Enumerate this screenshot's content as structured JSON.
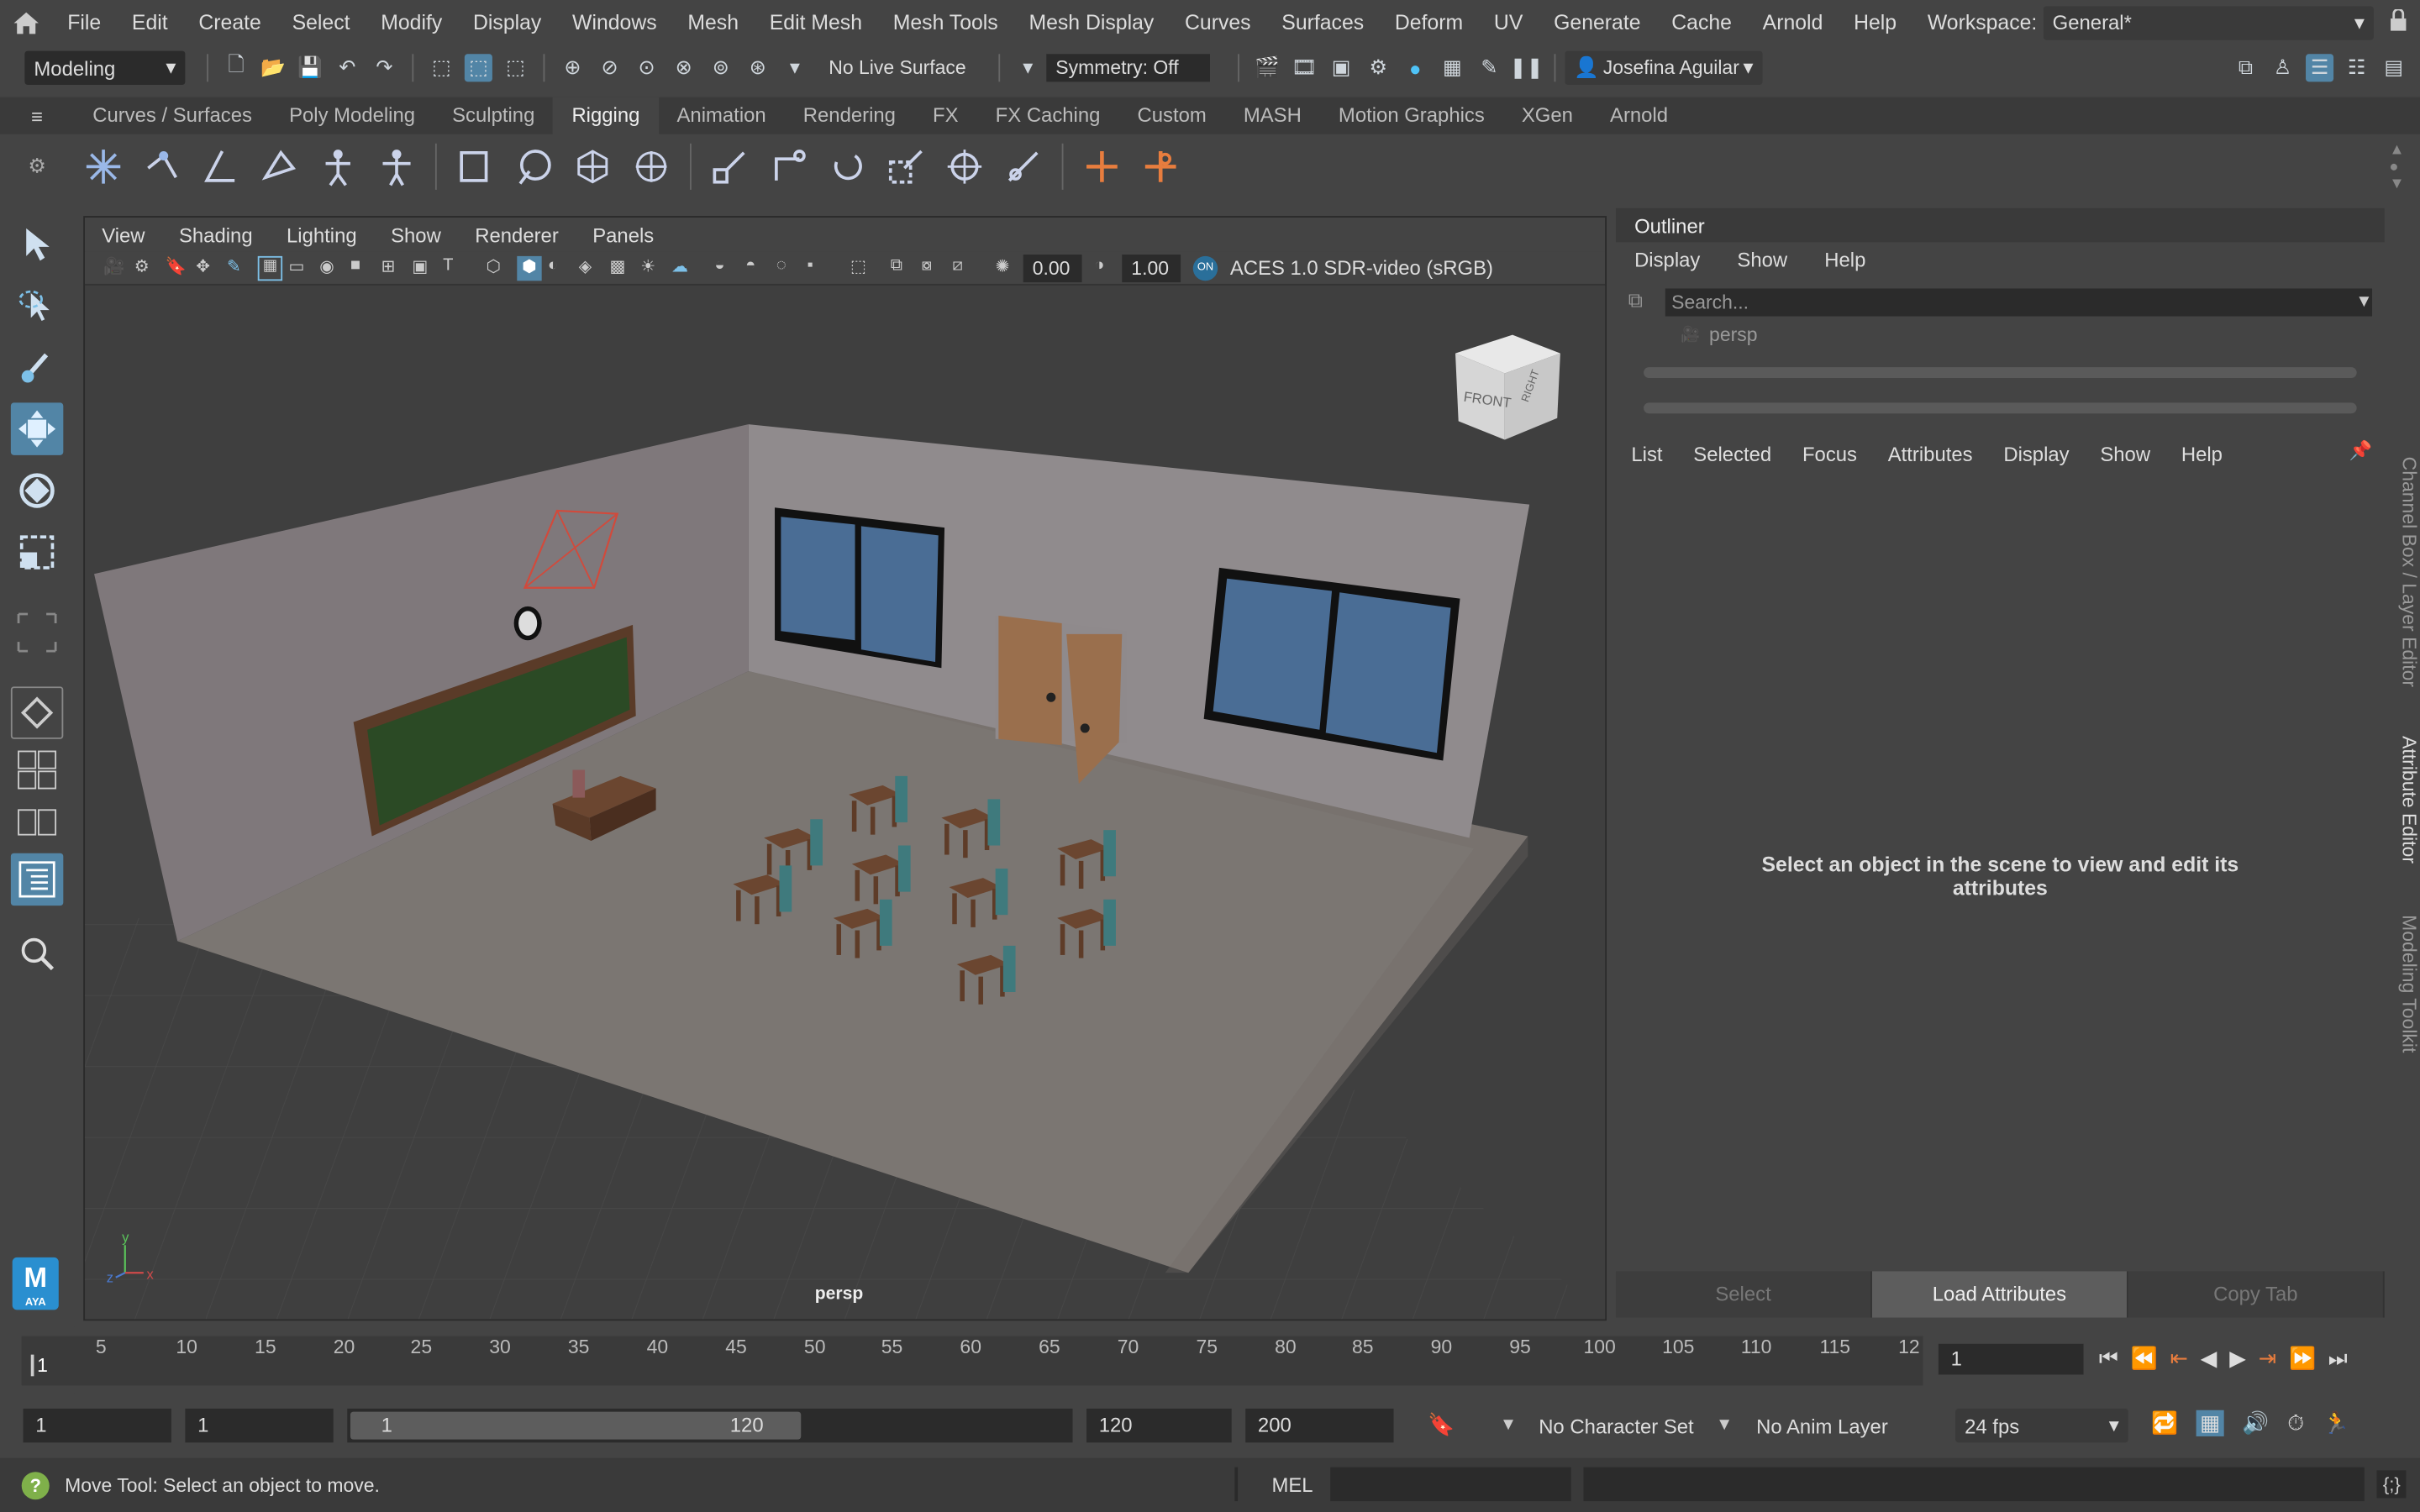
{
  "menubar": {
    "items": [
      "File",
      "Edit",
      "Create",
      "Select",
      "Modify",
      "Display",
      "Windows",
      "Mesh",
      "Edit Mesh",
      "Mesh Tools",
      "Mesh Display",
      "Curves",
      "Surfaces",
      "Deform",
      "UV",
      "Generate",
      "Cache",
      "Arnold",
      "Help"
    ],
    "workspace_label": "Workspace:",
    "workspace_value": "General*"
  },
  "statusline": {
    "mode": "Modeling",
    "live_surface": "No Live Surface",
    "symmetry": "Symmetry: Off",
    "user": "Josefina Aguilar"
  },
  "shelf": {
    "tabs": [
      "Curves / Surfaces",
      "Poly Modeling",
      "Sculpting",
      "Rigging",
      "Animation",
      "Rendering",
      "FX",
      "FX Caching",
      "Custom",
      "MASH",
      "Motion Graphics",
      "XGen",
      "Arnold"
    ],
    "active": "Rigging"
  },
  "viewport": {
    "menu": [
      "View",
      "Shading",
      "Lighting",
      "Show",
      "Renderer",
      "Panels"
    ],
    "exposure": "0.00",
    "gamma": "1.00",
    "colorspace": "ACES 1.0 SDR-video (sRGB)",
    "camera": "persp",
    "viewcube_front": "FRONT",
    "viewcube_right": "RIGHT",
    "axes": {
      "x": "x",
      "y": "y",
      "z": "z"
    }
  },
  "outliner": {
    "title": "Outliner",
    "menu": [
      "Display",
      "Show",
      "Help"
    ],
    "search_placeholder": "Search...",
    "item": "persp"
  },
  "attribute_editor": {
    "menu": [
      "List",
      "Selected",
      "Focus",
      "Attributes",
      "Display",
      "Show",
      "Help"
    ],
    "message": "Select an object in the scene to view and edit its attributes",
    "buttons": [
      "Select",
      "Load Attributes",
      "Copy Tab"
    ]
  },
  "side_tabs": [
    "Channel Box / Layer Editor",
    "Attribute Editor",
    "Modeling Toolkit"
  ],
  "timeline": {
    "ticks": [
      "5",
      "10",
      "15",
      "20",
      "25",
      "30",
      "35",
      "40",
      "45",
      "50",
      "55",
      "60",
      "65",
      "70",
      "75",
      "80",
      "85",
      "90",
      "95",
      "100",
      "105",
      "110",
      "115",
      "12"
    ],
    "current_frame_marker": "1",
    "current_frame": "1"
  },
  "range": {
    "start": "1",
    "start2": "1",
    "slider_start": "1",
    "slider_end": "120",
    "end": "120",
    "end2": "200",
    "character_set": "No Character Set",
    "anim_layer": "No Anim Layer",
    "fps": "24 fps"
  },
  "status": {
    "message": "Move Tool: Select an object to move.",
    "lang": "MEL"
  },
  "colors": {
    "accent": "#5285a6",
    "selection_blue": "#5285a6",
    "orange": "#e87d3e"
  }
}
